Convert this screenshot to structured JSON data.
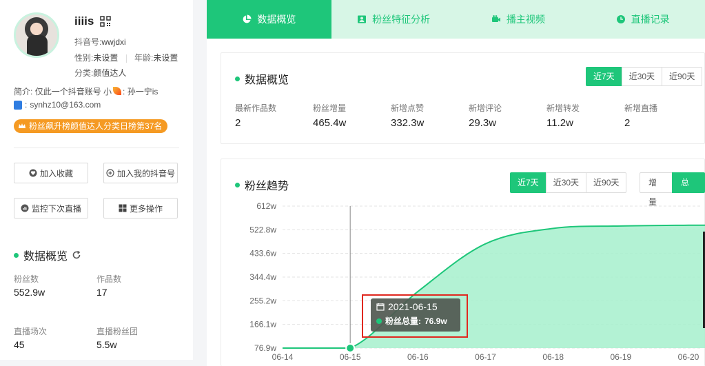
{
  "profile": {
    "username": "iiiis",
    "douyin_id_label": "抖音号:",
    "douyin_id": "wwjdxi",
    "gender_label": "性别:",
    "gender": "未设置",
    "age_label": "年龄:",
    "age": "未设置",
    "category_label": "分类:",
    "category": "颜值达人",
    "bio_label": "简介:",
    "bio_pre": "仅此一个抖音账号 小",
    "bio_post": ": 孙一宁is",
    "email_prefix": ":",
    "email": "synhz10@163.com",
    "rank_badge": "粉丝飙升榜颜值达人分类日榜第37名"
  },
  "actions": {
    "favorite": "加入收藏",
    "add_account": "加入我的抖音号",
    "monitor": "监控下次直播",
    "more": "更多操作"
  },
  "left_stats": {
    "title": "数据概览",
    "items": [
      {
        "label": "粉丝数",
        "value": "552.9w"
      },
      {
        "label": "作品数",
        "value": "17"
      },
      {
        "label": "直播场次",
        "value": "45"
      },
      {
        "label": "直播粉丝团",
        "value": "5.5w"
      }
    ]
  },
  "tabs": [
    "数据概览",
    "粉丝特征分析",
    "播主视频",
    "直播记录"
  ],
  "overview": {
    "title": "数据概览",
    "ranges": [
      "近7天",
      "近30天",
      "近90天"
    ],
    "active_range": 0,
    "metrics": [
      {
        "label": "最新作品数",
        "value": "2"
      },
      {
        "label": "粉丝增量",
        "value": "465.4w"
      },
      {
        "label": "新增点赞",
        "value": "332.3w"
      },
      {
        "label": "新增评论",
        "value": "29.3w"
      },
      {
        "label": "新增转发",
        "value": "11.2w"
      },
      {
        "label": "新增直播",
        "value": "2"
      }
    ]
  },
  "trend": {
    "title": "粉丝趋势",
    "ranges": [
      "近7天",
      "近30天",
      "近90天"
    ],
    "modes": [
      "增量",
      "总量"
    ],
    "active_mode": 1
  },
  "tooltip": {
    "date": "2021-06-15",
    "label": "粉丝总量:",
    "value": "76.9w"
  },
  "colors": {
    "accent": "#1ec67a",
    "badge": "#f59a23",
    "highlight": "#e0281f"
  },
  "chart_data": {
    "type": "area",
    "title": "粉丝趋势",
    "x": [
      "06-14",
      "06-15",
      "06-16",
      "06-17",
      "06-18",
      "06-19",
      "06-20"
    ],
    "series": [
      {
        "name": "粉丝总量",
        "values": [
          76.9,
          76.9,
          290,
          470,
          528,
          537,
          540
        ]
      }
    ],
    "y_ticks": [
      "76.9w",
      "166.1w",
      "255.2w",
      "344.4w",
      "433.6w",
      "522.8w",
      "612w"
    ],
    "ylim": [
      76.9,
      612
    ],
    "grid": true,
    "hover_index": 1
  }
}
